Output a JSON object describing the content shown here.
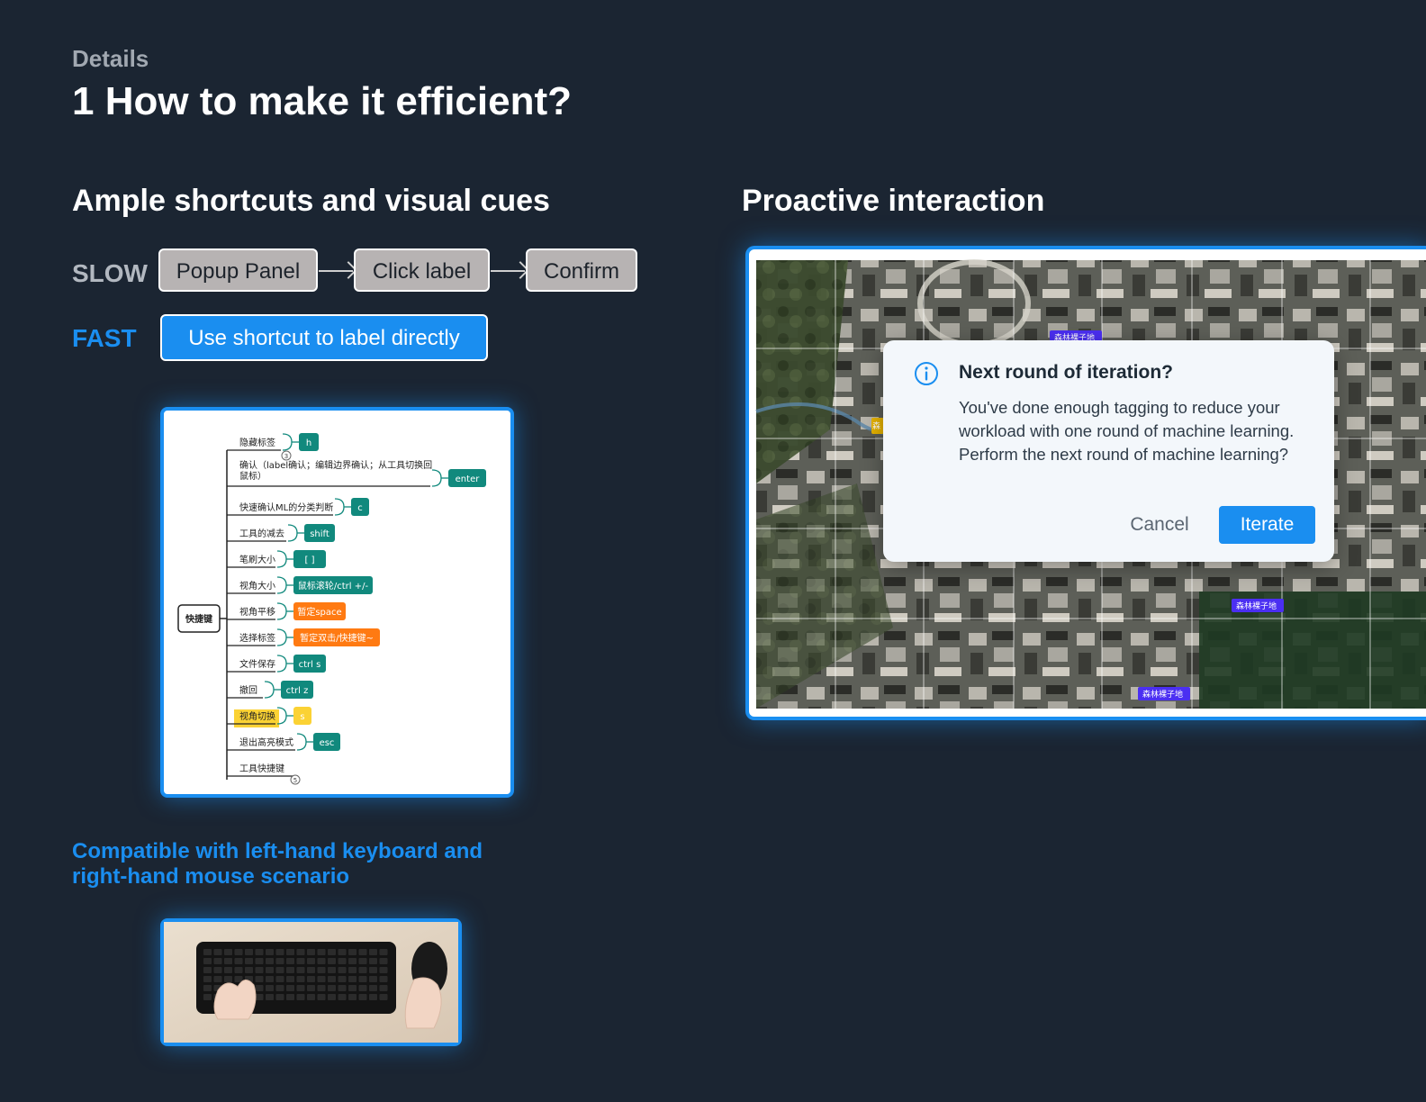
{
  "header": {
    "eyebrow": "Details",
    "title": "1 How to make it efficient?"
  },
  "left": {
    "title": "Ample shortcuts and visual cues",
    "slow": {
      "label": "SLOW",
      "steps": [
        "Popup Panel",
        "Click label",
        "Confirm"
      ]
    },
    "fast": {
      "label": "FAST",
      "step": "Use shortcut to label directly"
    },
    "mindmap": {
      "root": "快捷键",
      "items": [
        {
          "label": "隐藏标签",
          "key": "h"
        },
        {
          "label": "确认（label确认；编辑边界确认；从工具切换回",
          "label2": "鼠标）",
          "key": "enter"
        },
        {
          "label": "快速确认ML的分类判断",
          "key": "c"
        },
        {
          "label": "工具的减去",
          "key": "shift"
        },
        {
          "label": "笔刷大小",
          "key": "[ ]"
        },
        {
          "label": "视角大小",
          "key": "鼠标滚轮/ctrl +/-"
        },
        {
          "label": "视角平移",
          "key": "暂定space"
        },
        {
          "label": "选择标签",
          "key": "暂定双击/快捷键~"
        },
        {
          "label": "文件保存",
          "key": "ctrl s"
        },
        {
          "label": "撤回",
          "key": "ctrl z"
        },
        {
          "label": "视角切换",
          "key": "s"
        },
        {
          "label": "退出高亮模式",
          "key": "esc"
        },
        {
          "label": "工具快捷键",
          "key": ""
        }
      ],
      "badges": [
        "3",
        "5"
      ]
    },
    "note": "Compatible with left-hand keyboard and right-hand mouse scenario"
  },
  "right": {
    "title": "Proactive interaction",
    "map_tags": [
      "森林裸子地",
      "森",
      "森林裸子地",
      "森林裸子地"
    ],
    "dialog": {
      "icon": "info-icon",
      "title": "Next round of iteration?",
      "body": "You've done enough tagging to reduce your workload with one round of machine learning. Perform the next round of machine learning?",
      "cancel": "Cancel",
      "confirm": "Iterate"
    }
  },
  "colors": {
    "background": "#1b2532",
    "accent": "#1a8ef0",
    "key_teal": "#11897d",
    "key_orange": "#ff7a12",
    "key_yellow": "#fbd234",
    "map_tag": "#4b2ff2"
  }
}
